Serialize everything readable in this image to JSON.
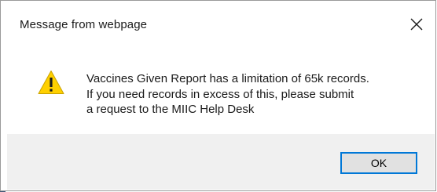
{
  "dialog": {
    "title": "Message from webpage",
    "close_icon": "close-icon",
    "warning_icon": "warning-icon",
    "message_lines": [
      "Vaccines Given Report has a limitation of 65k records.",
      "If you need records in excess of this, please submit",
      "a request to the MIIC Help Desk"
    ],
    "ok_label": "OK"
  },
  "colors": {
    "accent": "#0078d7",
    "warning_fill": "#ffd000",
    "footer_bg": "#f0f0f0"
  }
}
